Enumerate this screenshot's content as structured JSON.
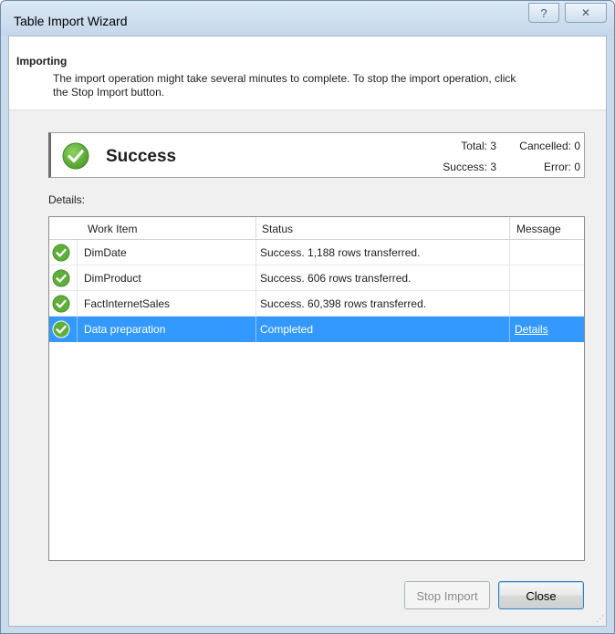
{
  "window": {
    "title": "Table Import Wizard",
    "help_glyph": "?",
    "close_glyph": "✕"
  },
  "header": {
    "title": "Importing",
    "description": "The import operation might take several minutes to complete. To stop the import operation, click the Stop Import button."
  },
  "summary": {
    "status": "Success",
    "icon": "check-circle-icon",
    "total": "Total: 3",
    "cancelled": "Cancelled: 0",
    "success": "Success: 3",
    "error": "Error: 0"
  },
  "details": {
    "label": "Details:",
    "columns": {
      "work_item": "Work Item",
      "status": "Status",
      "message": "Message"
    },
    "rows": [
      {
        "work_item": "DimDate",
        "status": "Success. 1,188 rows transferred.",
        "message": ""
      },
      {
        "work_item": "DimProduct",
        "status": "Success. 606 rows transferred.",
        "message": ""
      },
      {
        "work_item": "FactInternetSales",
        "status": "Success. 60,398 rows transferred.",
        "message": ""
      },
      {
        "work_item": "Data preparation",
        "status": "Completed",
        "message": "Details"
      }
    ]
  },
  "buttons": {
    "stop_import": "Stop Import",
    "close": "Close"
  },
  "colors": {
    "success_green": "#5fae3a",
    "selection_blue": "#3399ff"
  }
}
